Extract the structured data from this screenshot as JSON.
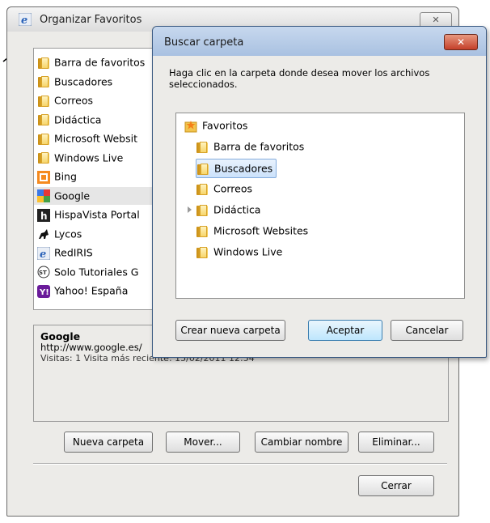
{
  "main_window": {
    "title": "Organizar Favoritos",
    "close_label": "✕",
    "favorites": [
      {
        "label": "Barra de favoritos",
        "icon": "folder-icon"
      },
      {
        "label": "Buscadores",
        "icon": "folder-icon"
      },
      {
        "label": "Correos",
        "icon": "folder-icon"
      },
      {
        "label": "Didáctica",
        "icon": "folder-icon"
      },
      {
        "label": "Microsoft Websit",
        "icon": "folder-icon"
      },
      {
        "label": "Windows Live",
        "icon": "folder-icon"
      },
      {
        "label": "Bing",
        "icon": "bing-icon"
      },
      {
        "label": "Google",
        "icon": "google-icon"
      },
      {
        "label": "HispaVista  Portal",
        "icon": "hispavista-icon"
      },
      {
        "label": "Lycos",
        "icon": "lycos-icon"
      },
      {
        "label": "RedIRIS",
        "icon": "ie-icon"
      },
      {
        "label": "Solo Tutoriales G",
        "icon": "solotutoriales-icon"
      },
      {
        "label": "Yahoo! España",
        "icon": "yahoo-icon"
      }
    ],
    "info": {
      "name": "Google",
      "url": "http://www.google.es/",
      "visits": "Visitas: 1   Visita más reciente: 15/02/2011 12:54"
    },
    "buttons": {
      "new_folder": "Nueva carpeta",
      "move": "Mover...",
      "rename": "Cambiar nombre",
      "delete": "Eliminar...",
      "close": "Cerrar"
    }
  },
  "dialog": {
    "title": "Buscar carpeta",
    "close_label": "✕",
    "instruction": "Haga clic en la carpeta donde desea mover los archivos seleccionados.",
    "tree_root": "Favoritos",
    "tree_items": [
      {
        "label": "Barra de favoritos",
        "selected": false,
        "expandable": false
      },
      {
        "label": "Buscadores",
        "selected": true,
        "expandable": false
      },
      {
        "label": "Correos",
        "selected": false,
        "expandable": false
      },
      {
        "label": "Didáctica",
        "selected": false,
        "expandable": true
      },
      {
        "label": "Microsoft Websites",
        "selected": false,
        "expandable": false
      },
      {
        "label": "Windows Live",
        "selected": false,
        "expandable": false
      }
    ],
    "buttons": {
      "create_folder": "Crear nueva carpeta",
      "accept": "Aceptar",
      "cancel": "Cancelar"
    }
  }
}
